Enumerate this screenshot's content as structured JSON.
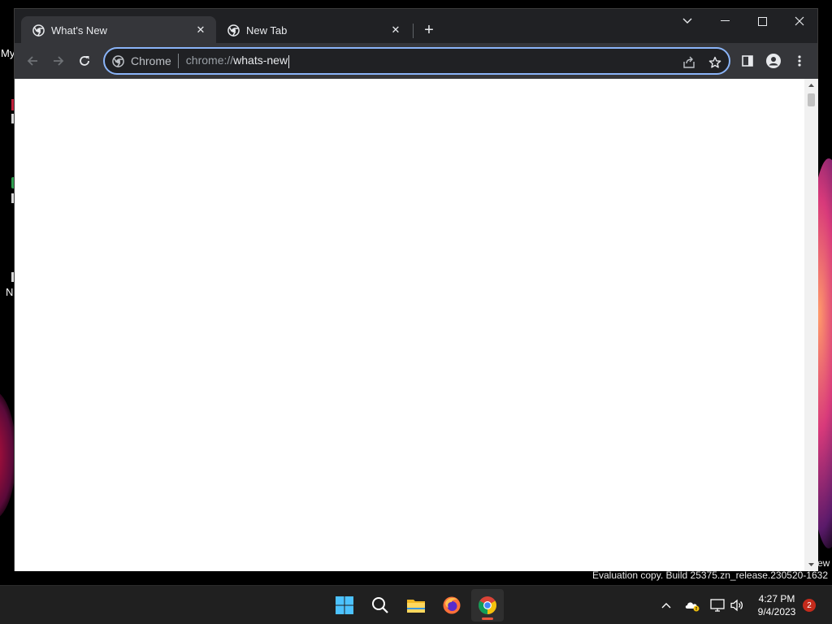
{
  "browser": {
    "tabs": [
      {
        "title": "What's New",
        "active": true,
        "favicon": "chrome-icon"
      },
      {
        "title": "New Tab",
        "active": false,
        "favicon": "chrome-icon"
      }
    ],
    "new_tab_icon": "plus-icon",
    "window_controls": [
      "tab-search-icon",
      "minimize-icon",
      "maximize-icon",
      "close-icon"
    ],
    "nav_icons": [
      "back-icon",
      "forward-icon",
      "reload-icon"
    ],
    "omnibox": {
      "chip_label": "Chrome",
      "url_scheme": "chrome://",
      "url_host": "whats-new",
      "focused_color": "#8ab4f8"
    },
    "toolbar_icons": [
      "share-icon",
      "bookmark-star-icon",
      "side-panel-icon",
      "profile-icon",
      "menu-icon"
    ]
  },
  "desktop": {
    "labels": [
      "My",
      "N"
    ]
  },
  "watermark": {
    "text": "Evaluation copy. Build 25375.zn_release.230520-1632",
    "fragment": "ew"
  },
  "taskbar": {
    "apps": [
      "windows-start-icon",
      "search-icon",
      "file-explorer-icon",
      "firefox-icon",
      "chrome-icon"
    ],
    "active_app": "chrome-icon",
    "clock": {
      "time": "4:27 PM",
      "date": "9/4/2023"
    },
    "notification_count": "2",
    "tray_icons": [
      "chevron-up-icon",
      "onedrive-icon",
      "network-icon",
      "volume-icon"
    ]
  },
  "colors": {
    "tab_strip": "#202124",
    "toolbar": "#35363a",
    "accent": "#8ab4f8",
    "taskbar": "#202020"
  }
}
